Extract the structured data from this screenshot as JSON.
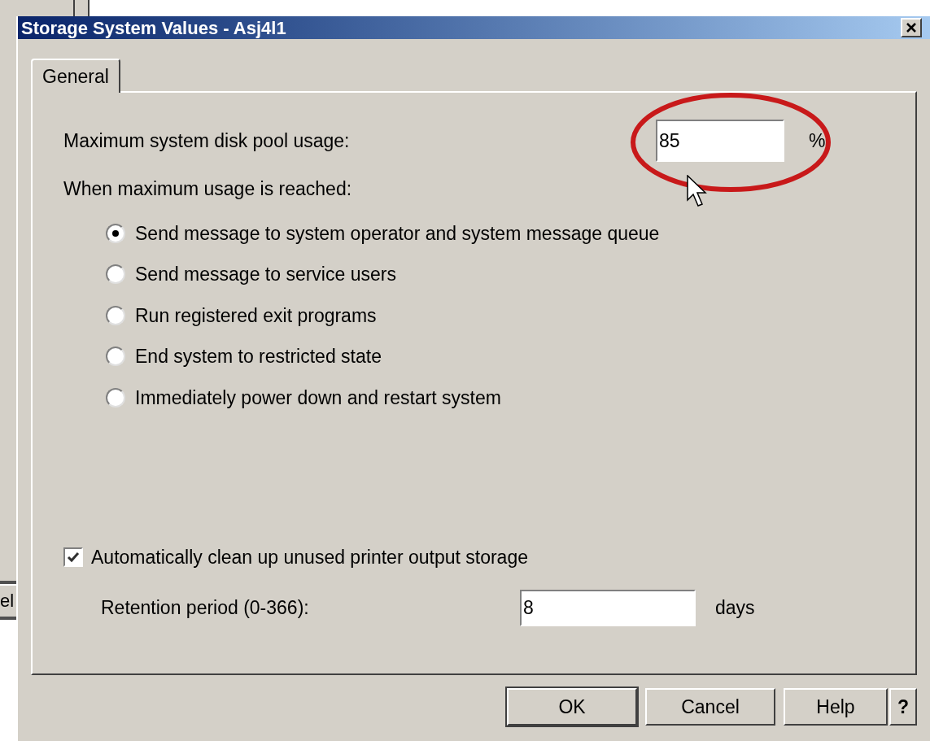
{
  "background_window": {
    "text": "el"
  },
  "window": {
    "title": "Storage System Values - Asj4l1"
  },
  "tabs": [
    {
      "label": "General",
      "selected": true
    }
  ],
  "usage": {
    "label": "Maximum system disk pool usage:",
    "value": "85",
    "unit": "%"
  },
  "annotation": {
    "kind": "ellipse",
    "color": "#c8191a"
  },
  "when_label": "When maximum usage is reached:",
  "actions": [
    {
      "label": "Send message to system operator and system message queue",
      "selected": true
    },
    {
      "label": "Send message to service users",
      "selected": false
    },
    {
      "label": "Run registered exit programs",
      "selected": false
    },
    {
      "label": "End system to restricted state",
      "selected": false
    },
    {
      "label": "Immediately power down and restart system",
      "selected": false
    }
  ],
  "cleanup": {
    "label": "Automatically clean up unused printer output storage",
    "checked": true
  },
  "retention": {
    "label": "Retention period (0-366):",
    "value": "8",
    "unit": "days"
  },
  "buttons": [
    {
      "label": "OK",
      "default": true
    },
    {
      "label": "Cancel",
      "default": false
    },
    {
      "label": "Help",
      "default": false
    },
    {
      "label": "?",
      "default": false
    }
  ]
}
